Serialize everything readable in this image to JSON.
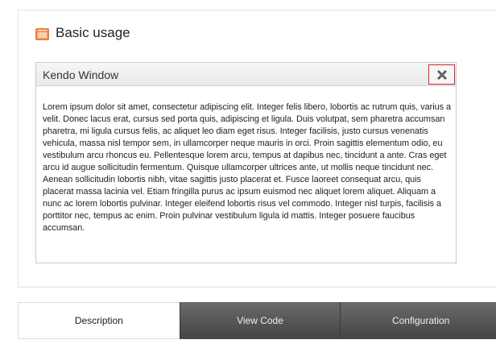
{
  "section": {
    "title": "Basic usage",
    "icon": "window-icon",
    "icon_color": "#f07d3a"
  },
  "window": {
    "title": "Kendo Window",
    "close_icon": "close-icon",
    "close_border_color": "#d9232e",
    "content": "Lorem ipsum dolor sit amet, consectetur adipiscing elit. Integer felis libero, lobortis ac rutrum quis, varius a velit. Donec lacus erat, cursus sed porta quis, adipiscing et ligula. Duis volutpat, sem pharetra accumsan pharetra, mi ligula cursus felis, ac aliquet leo diam eget risus. Integer facilisis, justo cursus venenatis vehicula, massa nisl tempor sem, in ullamcorper neque mauris in orci. Proin sagittis elementum odio, eu vestibulum arcu rhoncus eu. Pellentesque lorem arcu, tempus at dapibus nec, tincidunt a ante. Cras eget arcu id augue sollicitudin fermentum. Quisque ullamcorper ultrices ante, ut mollis neque tincidunt nec. Aenean sollicitudin lobortis nibh, vitae sagittis justo placerat et. Fusce laoreet consequat arcu, quis placerat massa lacinia vel. Etiam fringilla purus ac ipsum euismod nec aliquet lorem aliquet. Aliquam a nunc ac lorem lobortis pulvinar. Integer eleifend lobortis risus vel commodo. Integer nisl turpis, facilisis a porttitor nec, tempus ac enim. Proin pulvinar vestibulum ligula id mattis. Integer posuere faucibus accumsan."
  },
  "tabs": [
    {
      "label": "Description",
      "active": true
    },
    {
      "label": "View Code",
      "active": false
    },
    {
      "label": "Configuration",
      "active": false
    }
  ]
}
